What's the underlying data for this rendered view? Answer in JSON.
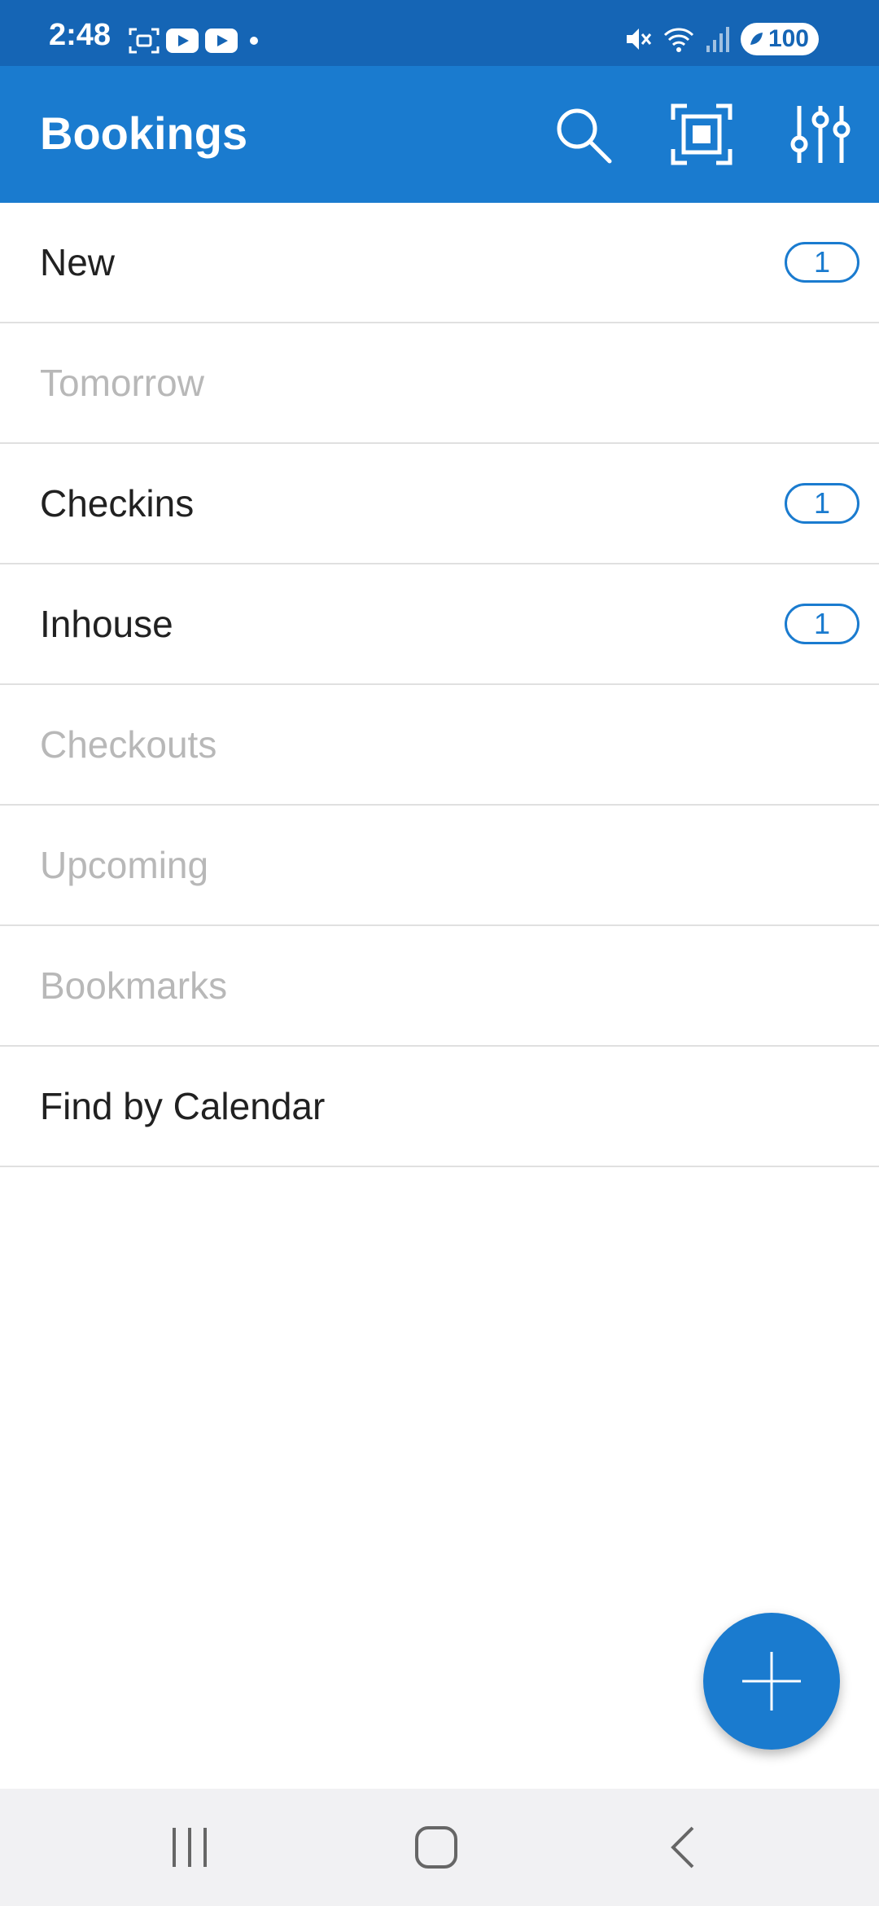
{
  "status_bar": {
    "time": "2:48",
    "battery": "100",
    "icons_left": [
      "screenshot-icon",
      "youtube-icon",
      "youtube-icon",
      "dot-icon"
    ],
    "icons_right": [
      "mute-icon",
      "wifi-icon",
      "signal-icon",
      "battery-icon"
    ]
  },
  "app_bar": {
    "title": "Bookings",
    "actions": [
      "search-icon",
      "scan-icon",
      "filter-sliders-icon"
    ],
    "color": "#1a7bcf"
  },
  "list": {
    "items": [
      {
        "label": "New",
        "count": "1",
        "enabled": true
      },
      {
        "label": "Tomorrow",
        "count": "",
        "enabled": false
      },
      {
        "label": "Checkins",
        "count": "1",
        "enabled": true
      },
      {
        "label": "Inhouse",
        "count": "1",
        "enabled": true
      },
      {
        "label": "Checkouts",
        "count": "",
        "enabled": false
      },
      {
        "label": "Upcoming",
        "count": "",
        "enabled": false
      },
      {
        "label": "Bookmarks",
        "count": "",
        "enabled": false
      },
      {
        "label": "Find by Calendar",
        "count": "",
        "enabled": true
      }
    ]
  },
  "fab": {
    "icon": "plus-icon"
  },
  "nav_bar": {
    "buttons": [
      "recents-icon",
      "home-icon",
      "back-icon"
    ]
  }
}
